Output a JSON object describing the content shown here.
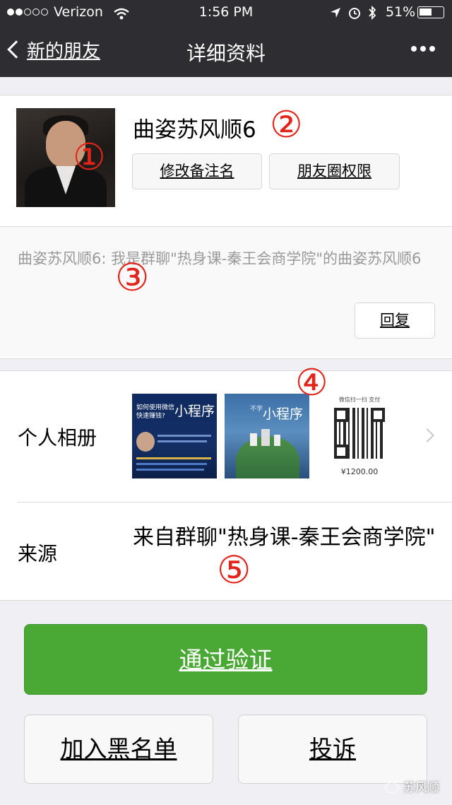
{
  "status_bar": {
    "carrier": "Verizon",
    "time": "1:56 PM",
    "battery": "51%"
  },
  "nav": {
    "back_label": "新的朋友",
    "title": "详细资料"
  },
  "profile": {
    "name": "曲姿苏风顺6",
    "edit_remark_button": "修改备注名",
    "moments_permission_button": "朋友圈权限"
  },
  "message": {
    "text": "曲姿苏风顺6: 我是群聊\"热身课-秦王会商学院\"的曲姿苏风顺6",
    "reply_button": "回复"
  },
  "album": {
    "label": "个人相册",
    "thumbs": [
      {
        "heading": "如何使用微信快速赚钱?",
        "title": "小程序"
      },
      {
        "small": "不学",
        "title": "小程序"
      },
      {
        "top": "微信扫一扫 支付",
        "price": "¥1200.00"
      }
    ]
  },
  "source": {
    "label": "来源",
    "value": "来自群聊\"热身课-秦王会商学院\""
  },
  "actions": {
    "verify_button": "通过验证",
    "blacklist_button": "加入黑名单",
    "report_button": "投诉"
  },
  "annotations": {
    "m1": "①",
    "m2": "②",
    "m3": "③",
    "m4": "④",
    "m5": "⑤"
  },
  "watermark": "苏风顺",
  "colors": {
    "navbar": "#2e2e32",
    "primary_green": "#4aa935",
    "annotation_red": "#e3241b",
    "background": "#efeff4"
  }
}
